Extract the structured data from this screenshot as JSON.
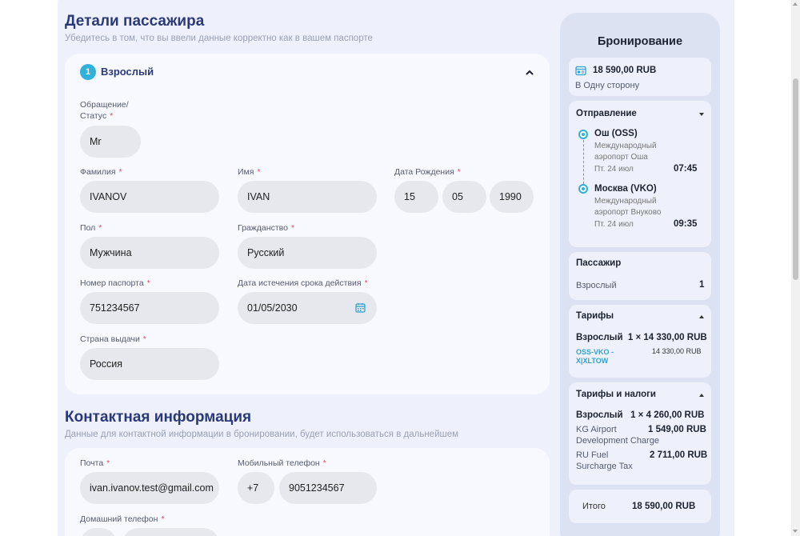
{
  "passenger": {
    "title": "Детали пассажира",
    "subtitle": "Убедитесь в том, что вы ввели данные корректно как в вашем паспорте",
    "badge_num": "1",
    "type": "Взрослый",
    "required_mark": "*",
    "fields": {
      "title_label": "Обращение/",
      "title_label_2": "Статус",
      "title_value": "Mr",
      "last_name_label": "Фамилия",
      "last_name_value": "IVANOV",
      "first_name_label": "Имя",
      "first_name_value": "IVAN",
      "dob_label": "Дата Рождения",
      "dob_day": "15",
      "dob_month": "05",
      "dob_year": "1990",
      "gender_label": "Пол",
      "gender_value": "Мужчина",
      "citizenship_label": "Гражданство",
      "citizenship_value": "Русский",
      "passport_label": "Номер паспорта",
      "passport_value": "751234567",
      "expiry_label": "Дата истечения срока действия",
      "expiry_value": "01/05/2030",
      "issuing_country_label": "Страна выдачи",
      "issuing_country_value": "Россия"
    }
  },
  "contact": {
    "title": "Контактная информация",
    "subtitle": "Данные для контактной информации в бронировании, будет использоваться в дальнейшем",
    "email_label": "Почта",
    "email_value": "ivan.ivanov.test@gmail.com",
    "mobile_label": "Мобильный телефон",
    "mobile_code": "+7",
    "mobile_value": "9051234567",
    "home_phone_label": "Домашний телефон"
  },
  "booking": {
    "title": "Бронирование",
    "total_price": "18 590,00 RUB",
    "trip_type": "В Одну сторону",
    "departure": {
      "heading": "Отправление",
      "from_city": "Ош (OSS)",
      "from_airport_1": "Международный",
      "from_airport_2": "аэропорт Оша",
      "from_date": "Пт. 24 июл",
      "from_time": "07:45",
      "to_city": "Москва (VKO)",
      "to_airport_1": "Международный",
      "to_airport_2": "аэропорт Внуково",
      "to_date": "Пт. 24 июл",
      "to_time": "09:35"
    },
    "passenger": {
      "heading": "Пассажир",
      "type": "Взрослый",
      "count": "1"
    },
    "fares": {
      "heading": "Тарифы",
      "line": "Взрослый  1 × 14 330,00 RUB",
      "route_1": "OSS-VKO -",
      "route_2": "X|XLTOW",
      "route_price": "14 330,00 RUB"
    },
    "taxes": {
      "heading": "Тарифы и налоги",
      "line": "Взрослый   1 × 4 260,00 RUB",
      "item1_name_1": "KG Airport",
      "item1_name_2": "Development Charge",
      "item1_price": "1 549,00 RUB",
      "item2_name_1": "RU Fuel",
      "item2_name_2": "Surcharge Tax",
      "item2_price": "2 711,00 RUB"
    },
    "total_label": "Итого",
    "total_value": "18 590,00 RUB"
  },
  "colors": {
    "accent": "#2fb0dd",
    "heading": "#2a3a78",
    "field_bg": "#e6e8ee",
    "required": "#e2475f"
  },
  "icons": [
    "chevron-up-icon",
    "calendar-icon",
    "ticket-icon",
    "chevron-down-icon",
    "scroll-arrow-up-icon",
    "scroll-arrow-down-icon"
  ]
}
